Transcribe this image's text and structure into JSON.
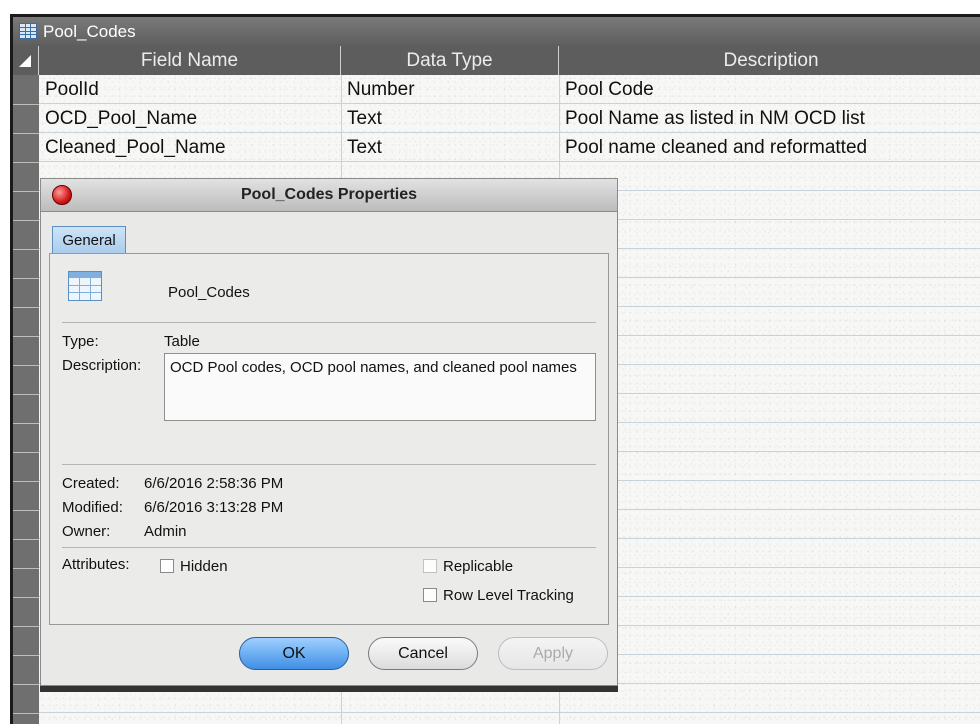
{
  "window": {
    "tab_title": "Pool_Codes"
  },
  "grid": {
    "headers": [
      "Field Name",
      "Data Type",
      "Description"
    ],
    "rows": [
      {
        "field": "PoolId",
        "type": "Number",
        "description": "Pool Code"
      },
      {
        "field": "OCD_Pool_Name",
        "type": "Text",
        "description": "Pool Name as listed in NM OCD list"
      },
      {
        "field": "Cleaned_Pool_Name",
        "type": "Text",
        "description": "Pool name cleaned and reformatted"
      }
    ]
  },
  "dialog": {
    "title": "Pool_Codes Properties",
    "tab_general": "General",
    "object_name": "Pool_Codes",
    "type_label": "Type:",
    "type_value": "Table",
    "description_label": "Description:",
    "description_value": "OCD Pool codes, OCD pool names, and cleaned pool names",
    "created_label": "Created:",
    "created_value": "6/6/2016 2:58:36 PM",
    "modified_label": "Modified:",
    "modified_value": "6/6/2016 3:13:28 PM",
    "owner_label": "Owner:",
    "owner_value": "Admin",
    "attributes_label": "Attributes:",
    "hidden_label": "Hidden",
    "replicable_label": "Replicable",
    "row_tracking_label": "Row Level Tracking",
    "ok_label": "OK",
    "cancel_label": "Cancel",
    "apply_label": "Apply"
  },
  "colors": {
    "header_bg": "#5d5d5d",
    "ok_button": "#3f8fe6",
    "close_button": "#d11818"
  }
}
